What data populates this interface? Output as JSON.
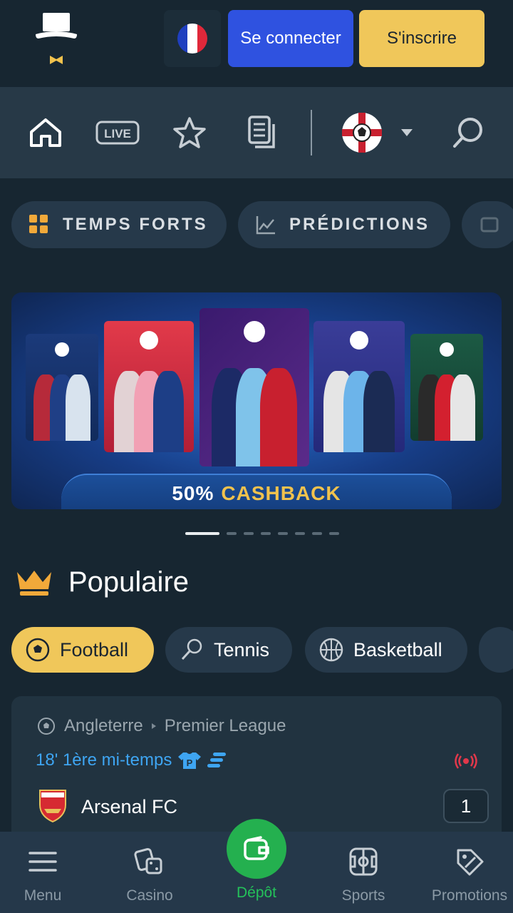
{
  "header": {
    "logo_icon": "top-hat-logo-icon",
    "language_flag": "france-flag-icon",
    "login_label": "Se connecter",
    "signup_label": "S'inscrire"
  },
  "nav": {
    "items": [
      "home-icon",
      "live-icon",
      "favorites-star-icon",
      "betslip-icon",
      "football-sport-selector-icon",
      "chevron-down-icon",
      "search-icon"
    ],
    "live_text": "LIVE"
  },
  "tabs": [
    {
      "label": "TEMPS FORTS",
      "icon": "grid-icon"
    },
    {
      "label": "PRÉDICTIONS",
      "icon": "chart-icon"
    }
  ],
  "banner": {
    "cashback_prefix": "50%",
    "cashback_word": "CASHBACK",
    "slides_total": 8,
    "active_slide": 1
  },
  "popular": {
    "title": "Populaire",
    "sports": [
      {
        "label": "Football",
        "icon": "football-icon",
        "active": true
      },
      {
        "label": "Tennis",
        "icon": "tennis-racket-icon",
        "active": false
      },
      {
        "label": "Basketball",
        "icon": "basketball-icon",
        "active": false
      }
    ]
  },
  "match": {
    "country": "Angleterre",
    "league": "Premier League",
    "status": "18' 1ère mi-temps",
    "team_home": "Arsenal FC",
    "score_home": "1"
  },
  "bottom_nav": {
    "menu": "Menu",
    "casino": "Casino",
    "deposit": "Dépôt",
    "sports": "Sports",
    "promotions": "Promotions"
  },
  "colors": {
    "background": "#172631",
    "login_blue": "#2f52e0",
    "signup_gold": "#f0c75a",
    "deposit_green": "#24b04f",
    "live_blue": "#3ea5f2"
  }
}
